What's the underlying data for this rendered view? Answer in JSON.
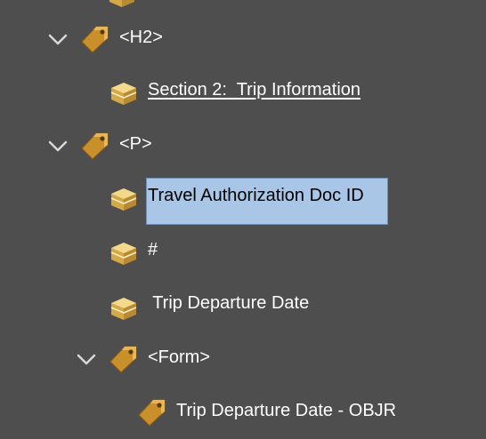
{
  "colors": {
    "background": "#4e4e4e",
    "selection": "#a9c6e6",
    "text": "#ffffff",
    "selected_text": "#000000",
    "tag": "#c98f2a",
    "box": "#d9b257"
  },
  "tree": {
    "nodes": [
      {
        "label": "<H2>",
        "icon": "tag-icon",
        "expanded": true
      },
      {
        "label": "Section 2:  Trip Information",
        "icon": "box-icon",
        "underlined": true
      },
      {
        "label": "<P>",
        "icon": "tag-icon",
        "expanded": true
      },
      {
        "label": "Travel Authorization Doc ID",
        "icon": "box-icon",
        "selected": true
      },
      {
        "label": "#",
        "icon": "box-icon"
      },
      {
        "label": " Trip Departure Date",
        "icon": "box-icon"
      },
      {
        "label": "<Form>",
        "icon": "tag-icon",
        "expanded": true
      },
      {
        "label": "Trip Departure Date - OBJR",
        "icon": "tag-icon"
      }
    ]
  }
}
